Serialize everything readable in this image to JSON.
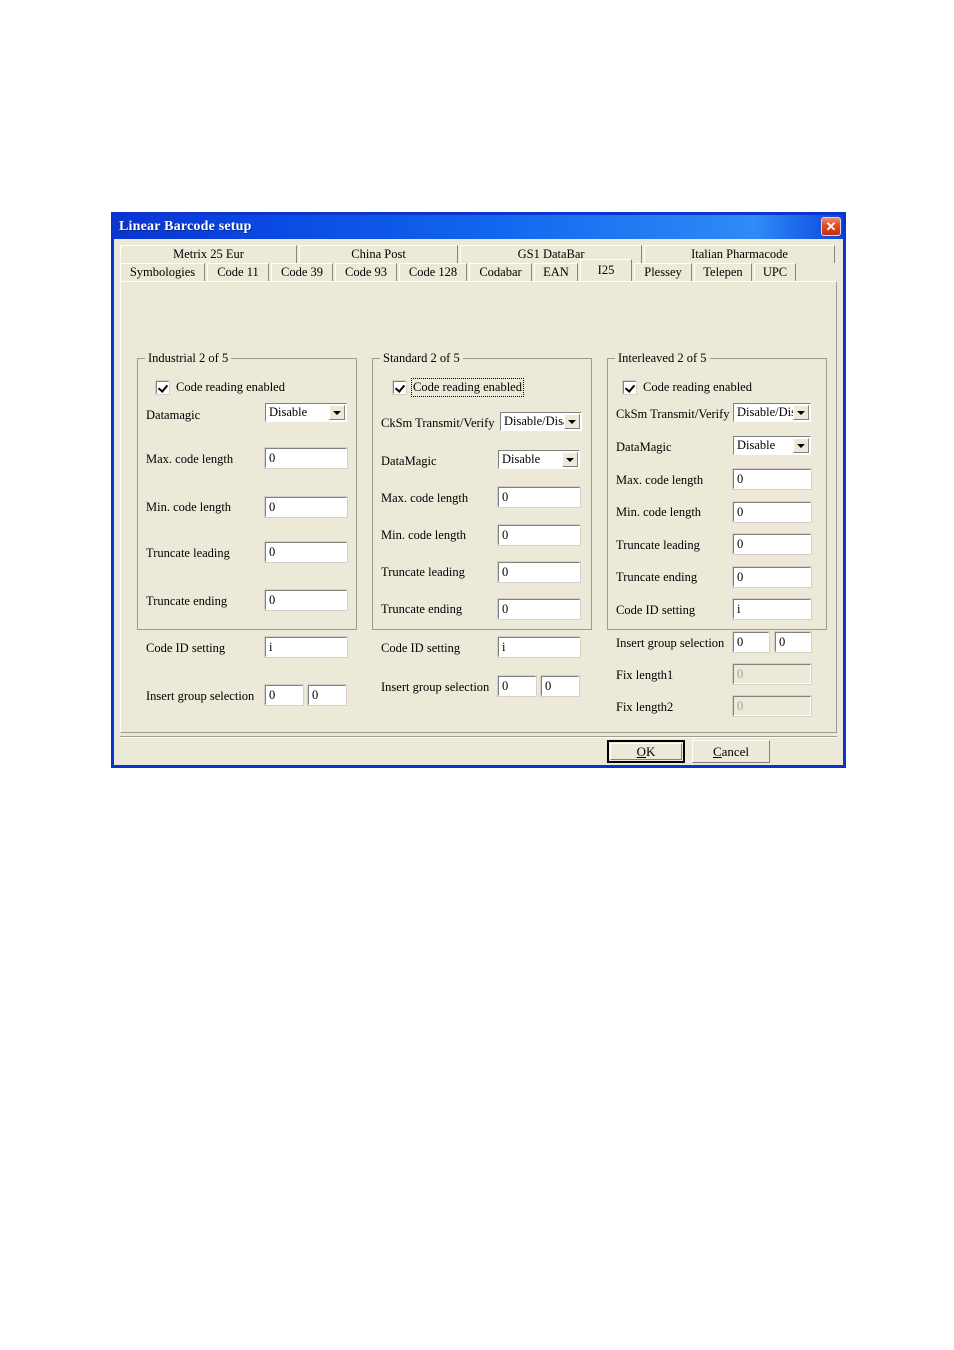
{
  "window": {
    "title": "Linear Barcode setup",
    "close_icon": "close-icon",
    "close_glyph": "✕",
    "title_bar_color": "#0a46e0",
    "face_color": "#ece9d8",
    "border_color": "#0a35cf"
  },
  "tabs": {
    "row1": [
      {
        "label": "Metrix 25 Eur",
        "selected": false
      },
      {
        "label": "China Post",
        "selected": false
      },
      {
        "label": "GS1 DataBar",
        "selected": false
      },
      {
        "label": "Italian Pharmacode",
        "selected": false
      }
    ],
    "row2": [
      {
        "label": "Symbologies",
        "selected": false
      },
      {
        "label": "Code 11",
        "selected": false
      },
      {
        "label": "Code 39",
        "selected": false
      },
      {
        "label": "Code 93",
        "selected": false
      },
      {
        "label": "Code 128",
        "selected": false
      },
      {
        "label": "Codabar",
        "selected": false
      },
      {
        "label": "EAN",
        "selected": false
      },
      {
        "label": "I25",
        "selected": true
      },
      {
        "label": "Plessey",
        "selected": false
      },
      {
        "label": "Telepen",
        "selected": false
      },
      {
        "label": "UPC",
        "selected": false
      }
    ]
  },
  "groups": {
    "industrial": {
      "title": "Industrial 2 of 5",
      "code_reading_label": "Code reading enabled",
      "code_reading_checked": true,
      "code_reading_focused": false,
      "datamagic_label": "Datamagic",
      "datamagic_value": "Disable",
      "max_label": "Max. code length",
      "max_value": "0",
      "min_label": "Min. code length",
      "min_value": "0",
      "trunc_leading_label": "Truncate leading",
      "trunc_leading_value": "0",
      "trunc_ending_label": "Truncate ending",
      "trunc_ending_value": "0",
      "code_id_label": "Code ID setting",
      "code_id_value": "i",
      "insert_group_label": "Insert group selection",
      "insert_group_value1": "0",
      "insert_group_value2": "0"
    },
    "standard": {
      "title": "Standard 2 of 5",
      "code_reading_label": "Code reading enabled",
      "code_reading_checked": true,
      "code_reading_focused": true,
      "cksm_label": "CkSm Transmit/Verify",
      "cksm_value": "Disable/Disab",
      "datamagic_label": "DataMagic",
      "datamagic_value": "Disable",
      "max_label": "Max. code length",
      "max_value": "0",
      "min_label": "Min. code length",
      "min_value": "0",
      "trunc_leading_label": "Truncate leading",
      "trunc_leading_value": "0",
      "trunc_ending_label": "Truncate ending",
      "trunc_ending_value": "0",
      "code_id_label": "Code ID setting",
      "code_id_value": "i",
      "insert_group_label": "Insert group selection",
      "insert_group_value1": "0",
      "insert_group_value2": "0"
    },
    "interleaved": {
      "title": "Interleaved 2 of 5",
      "code_reading_label": "Code reading enabled",
      "code_reading_checked": true,
      "code_reading_focused": false,
      "cksm_label": "CkSm Transmit/Verify",
      "cksm_value": "Disable/Disa",
      "datamagic_label": "DataMagic",
      "datamagic_value": "Disable",
      "max_label": "Max. code length",
      "max_value": "0",
      "min_label": "Min. code length",
      "min_value": "0",
      "trunc_leading_label": "Truncate leading",
      "trunc_leading_value": "0",
      "trunc_ending_label": "Truncate ending",
      "trunc_ending_value": "0",
      "code_id_label": "Code ID setting",
      "code_id_value": "i",
      "insert_group_label": "Insert group selection",
      "insert_group_value1": "0",
      "insert_group_value2": "0",
      "fix_length1_label": "Fix length1",
      "fix_length1_value": "0",
      "fix_length1_disabled": true,
      "fix_length2_label": "Fix length2",
      "fix_length2_value": "0",
      "fix_length2_disabled": true
    }
  },
  "buttons": {
    "ok": "OK",
    "ok_accel": "K",
    "cancel": "Cancel",
    "cancel_accel": "C"
  }
}
